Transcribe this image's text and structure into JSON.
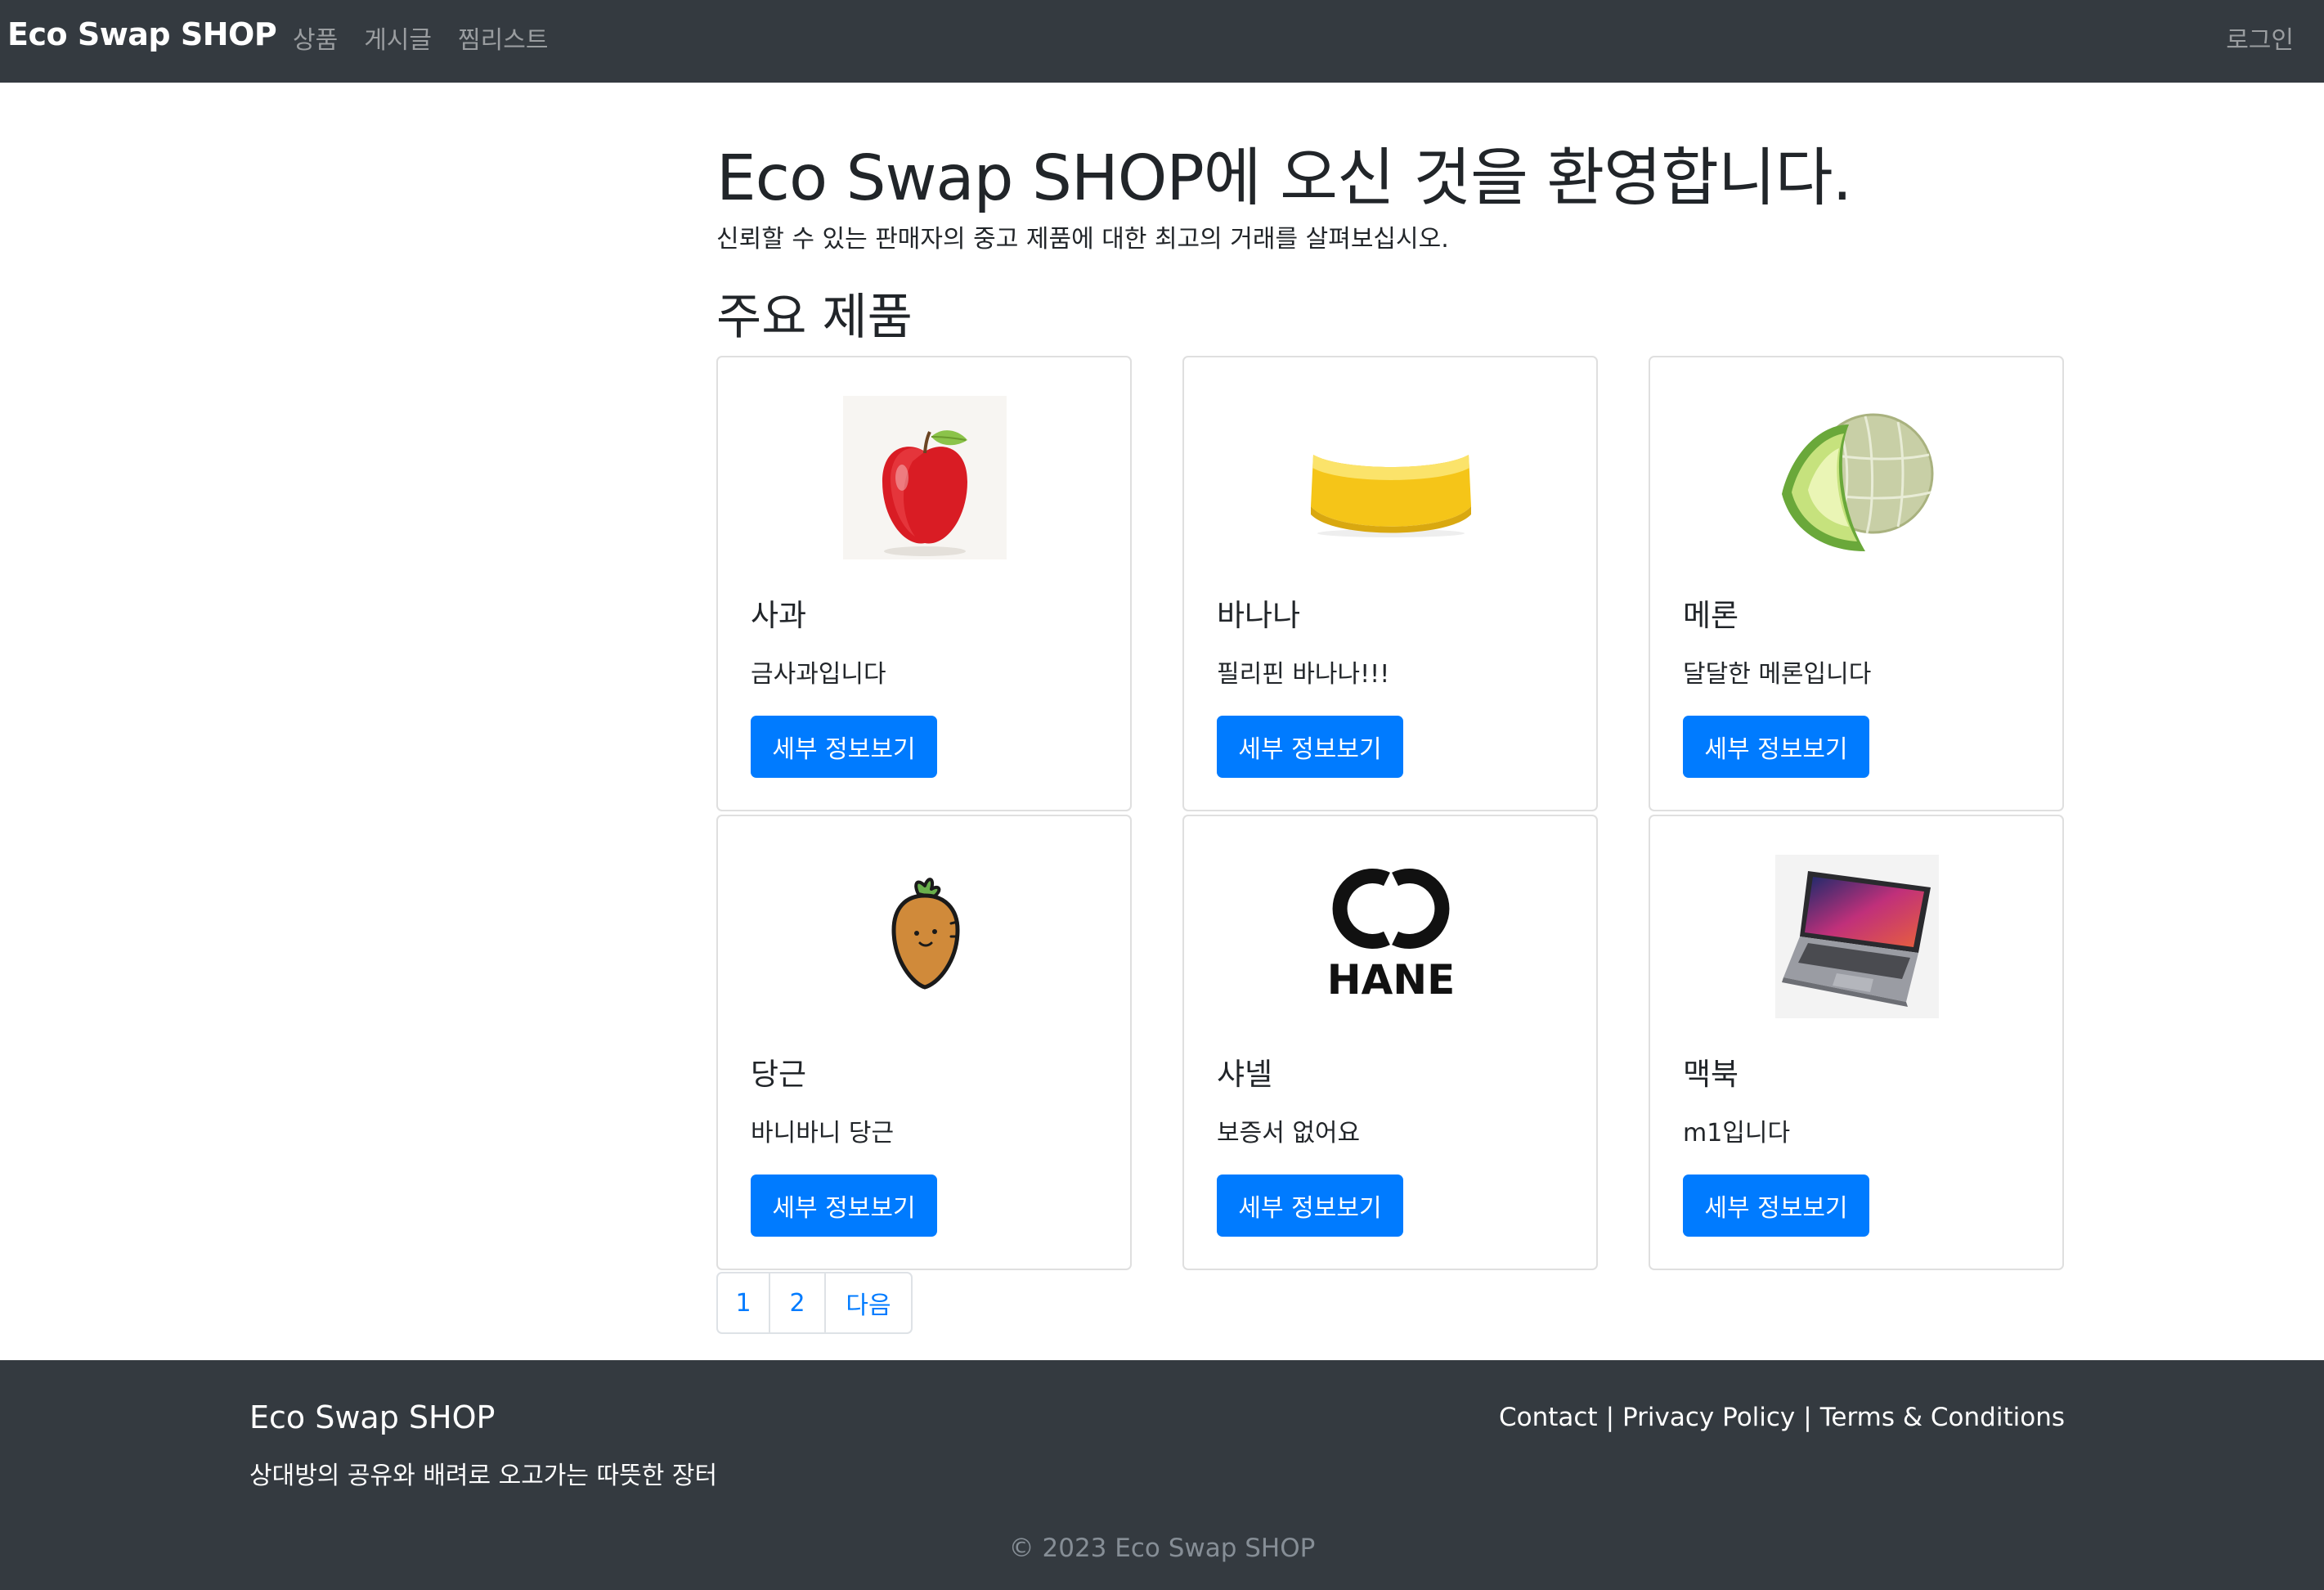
{
  "navbar": {
    "brand": "Eco Swap SHOP",
    "links": [
      "상품",
      "게시글",
      "찜리스트"
    ],
    "login": "로그인"
  },
  "hero": {
    "title": "Eco Swap SHOP에 오신 것을 환영합니다.",
    "subtitle": "신뢰할 수 있는 판매자의 중고 제품에 대한 최고의 거래를 살펴보십시오."
  },
  "section": {
    "title": "주요 제품"
  },
  "products": [
    {
      "name": "사과",
      "description": "금사과입니다",
      "button": "세부 정보보기",
      "icon": "apple-icon"
    },
    {
      "name": "바나나",
      "description": "필리핀 바나나!!!",
      "button": "세부 정보보기",
      "icon": "banana-icon"
    },
    {
      "name": "메론",
      "description": "달달한 메론입니다",
      "button": "세부 정보보기",
      "icon": "melon-icon"
    },
    {
      "name": "당근",
      "description": "바니바니 당근",
      "button": "세부 정보보기",
      "icon": "carrot-icon"
    },
    {
      "name": "샤넬",
      "description": "보증서 없어요",
      "button": "세부 정보보기",
      "icon": "chanel-logo-icon"
    },
    {
      "name": "맥북",
      "description": "m1입니다",
      "button": "세부 정보보기",
      "icon": "laptop-icon"
    }
  ],
  "pagination": {
    "pages": [
      "1",
      "2"
    ],
    "next": "다음"
  },
  "footer": {
    "brand": "Eco Swap SHOP",
    "tagline": "상대방의 공유와 배려로 오고가는 따뜻한 장터",
    "links": [
      "Contact",
      "Privacy Policy",
      "Terms & Conditions"
    ],
    "separator": "|",
    "copyright": "© 2023 Eco Swap SHOP",
    "logo_text": "HANE"
  },
  "colors": {
    "navbar_bg": "#343a40",
    "primary": "#007bff",
    "footer_bg": "#343a40"
  }
}
